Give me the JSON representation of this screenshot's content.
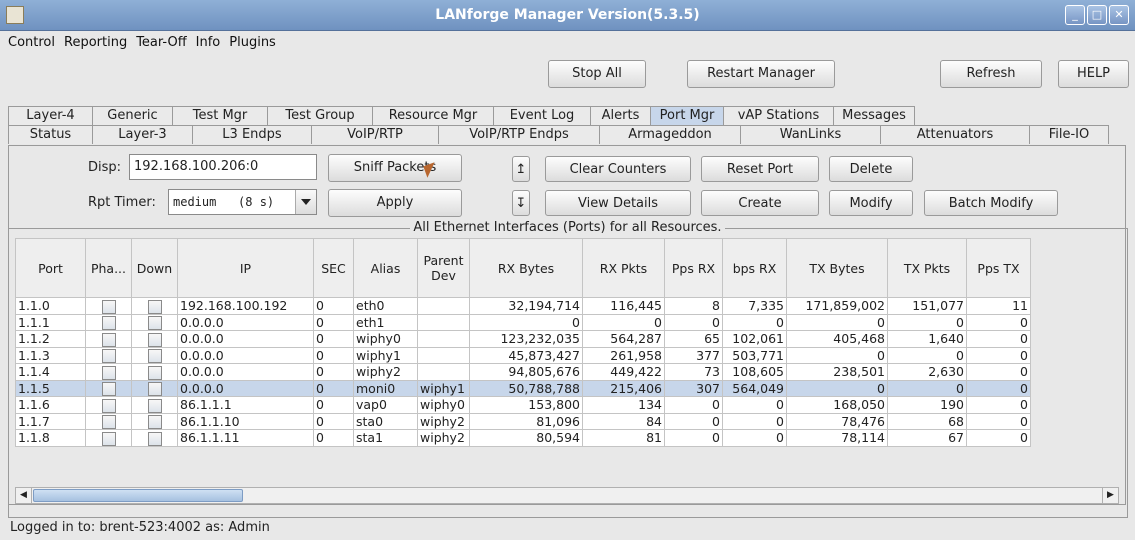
{
  "window": {
    "title": "LANforge Manager   Version(5.3.5)"
  },
  "menu": [
    "Control",
    "Reporting",
    "Tear-Off",
    "Info",
    "Plugins"
  ],
  "toolbar": {
    "stop_all": "Stop All",
    "restart": "Restart Manager",
    "refresh": "Refresh",
    "help": "HELP"
  },
  "tabs_row1": [
    "Layer-4",
    "Generic",
    "Test Mgr",
    "Test Group",
    "Resource Mgr",
    "Event Log",
    "Alerts",
    "Port Mgr",
    "vAP Stations",
    "Messages"
  ],
  "tabs_row2": [
    "Status",
    "Layer-3",
    "L3 Endps",
    "VoIP/RTP",
    "VoIP/RTP Endps",
    "Armageddon",
    "WanLinks",
    "Attenuators",
    "File-IO"
  ],
  "active_tab": "Port Mgr",
  "controls": {
    "disp_label": "Disp:",
    "disp_value": "192.168.100.206:0",
    "rpt_label": "Rpt Timer:",
    "rpt_value": "medium   (8 s)",
    "sniff": "Sniff Packets",
    "apply": "Apply",
    "clear": "Clear Counters",
    "reset": "Reset Port",
    "delete": "Delete",
    "view": "View Details",
    "create": "Create",
    "modify": "Modify",
    "batch": "Batch Modify",
    "up_arrow": "↥",
    "down_arrow": "↧"
  },
  "table": {
    "title": "All Ethernet Interfaces (Ports) for all Resources.",
    "columns": [
      "Port",
      "Pha...",
      "Down",
      "IP",
      "SEC",
      "Alias",
      "Parent Dev",
      "RX Bytes",
      "RX Pkts",
      "Pps RX",
      "bps RX",
      "TX Bytes",
      "TX Pkts",
      "Pps TX"
    ],
    "rows": [
      [
        "1.1.0",
        "",
        "",
        "192.168.100.192",
        "0",
        "eth0",
        "",
        "32,194,714",
        "116,445",
        "8",
        "7,335",
        "171,859,002",
        "151,077",
        "11"
      ],
      [
        "1.1.1",
        "",
        "",
        "0.0.0.0",
        "0",
        "eth1",
        "",
        "0",
        "0",
        "0",
        "0",
        "0",
        "0",
        "0"
      ],
      [
        "1.1.2",
        "",
        "",
        "0.0.0.0",
        "0",
        "wiphy0",
        "",
        "123,232,035",
        "564,287",
        "65",
        "102,061",
        "405,468",
        "1,640",
        "0"
      ],
      [
        "1.1.3",
        "",
        "",
        "0.0.0.0",
        "0",
        "wiphy1",
        "",
        "45,873,427",
        "261,958",
        "377",
        "503,771",
        "0",
        "0",
        "0"
      ],
      [
        "1.1.4",
        "",
        "",
        "0.0.0.0",
        "0",
        "wiphy2",
        "",
        "94,805,676",
        "449,422",
        "73",
        "108,605",
        "238,501",
        "2,630",
        "0"
      ],
      [
        "1.1.5",
        "",
        "",
        "0.0.0.0",
        "0",
        "moni0",
        "wiphy1",
        "50,788,788",
        "215,406",
        "307",
        "564,049",
        "0",
        "0",
        "0"
      ],
      [
        "1.1.6",
        "",
        "",
        "86.1.1.1",
        "0",
        "vap0",
        "wiphy0",
        "153,800",
        "134",
        "0",
        "0",
        "168,050",
        "190",
        "0"
      ],
      [
        "1.1.7",
        "",
        "",
        "86.1.1.10",
        "0",
        "sta0",
        "wiphy2",
        "81,096",
        "84",
        "0",
        "0",
        "78,476",
        "68",
        "0"
      ],
      [
        "1.1.8",
        "",
        "",
        "86.1.1.11",
        "0",
        "sta1",
        "wiphy2",
        "80,594",
        "81",
        "0",
        "0",
        "78,114",
        "67",
        "0"
      ]
    ],
    "selected_row": 5
  },
  "status": "Logged in to:  brent-523:4002  as:  Admin"
}
